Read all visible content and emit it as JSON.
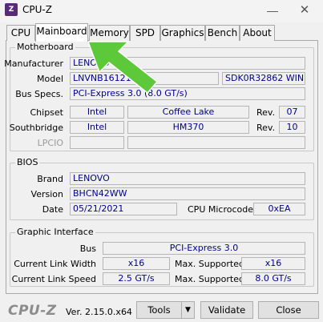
{
  "window": {
    "title": "CPU-Z",
    "app_icon_label": "Z",
    "minimize_glyph": "—",
    "close_glyph": "✕"
  },
  "tabs": [
    {
      "label": "CPU"
    },
    {
      "label": "Mainboard"
    },
    {
      "label": "Memory"
    },
    {
      "label": "SPD"
    },
    {
      "label": "Graphics"
    },
    {
      "label": "Bench"
    },
    {
      "label": "About"
    }
  ],
  "active_tab": "Mainboard",
  "motherboard": {
    "group_title": "Motherboard",
    "manufacturer_label": "Manufacturer",
    "manufacturer": "LENOVO",
    "model_label": "Model",
    "model": "LNVNB161216",
    "model_revision": "SDK0R32862 WIN",
    "bus_specs_label": "Bus Specs.",
    "bus_specs": "PCI-Express 3.0 (8.0 GT/s)",
    "chipset_label": "Chipset",
    "chipset_vendor": "Intel",
    "chipset_model": "Coffee Lake",
    "chipset_rev_label": "Rev.",
    "chipset_rev": "07",
    "southbridge_label": "Southbridge",
    "southbridge_vendor": "Intel",
    "southbridge_model": "HM370",
    "southbridge_rev_label": "Rev.",
    "southbridge_rev": "10",
    "lpcio_label": "LPCIO",
    "lpcio_vendor": "",
    "lpcio_model": ""
  },
  "bios": {
    "group_title": "BIOS",
    "brand_label": "Brand",
    "brand": "LENOVO",
    "version_label": "Version",
    "version": "BHCN42WW",
    "date_label": "Date",
    "date": "05/21/2021",
    "microcode_label": "CPU Microcode",
    "microcode": "0xEA"
  },
  "graphic_interface": {
    "group_title": "Graphic Interface",
    "bus_label": "Bus",
    "bus": "PCI-Express 3.0",
    "link_width_label": "Current Link Width",
    "link_width": "x16",
    "max_width_label": "Max. Supported",
    "max_width": "x16",
    "link_speed_label": "Current Link Speed",
    "link_speed": "2.5 GT/s",
    "max_speed_label": "Max. Supported",
    "max_speed": "8.0 GT/s"
  },
  "footer": {
    "logo": "CPU-Z",
    "version": "Ver. 2.15.0.x64",
    "tools_label": "Tools",
    "tools_arrow": "▼",
    "validate_label": "Validate",
    "close_label": "Close"
  },
  "colors": {
    "value_text": "#00008b",
    "annotation_arrow": "#5cc83a"
  }
}
